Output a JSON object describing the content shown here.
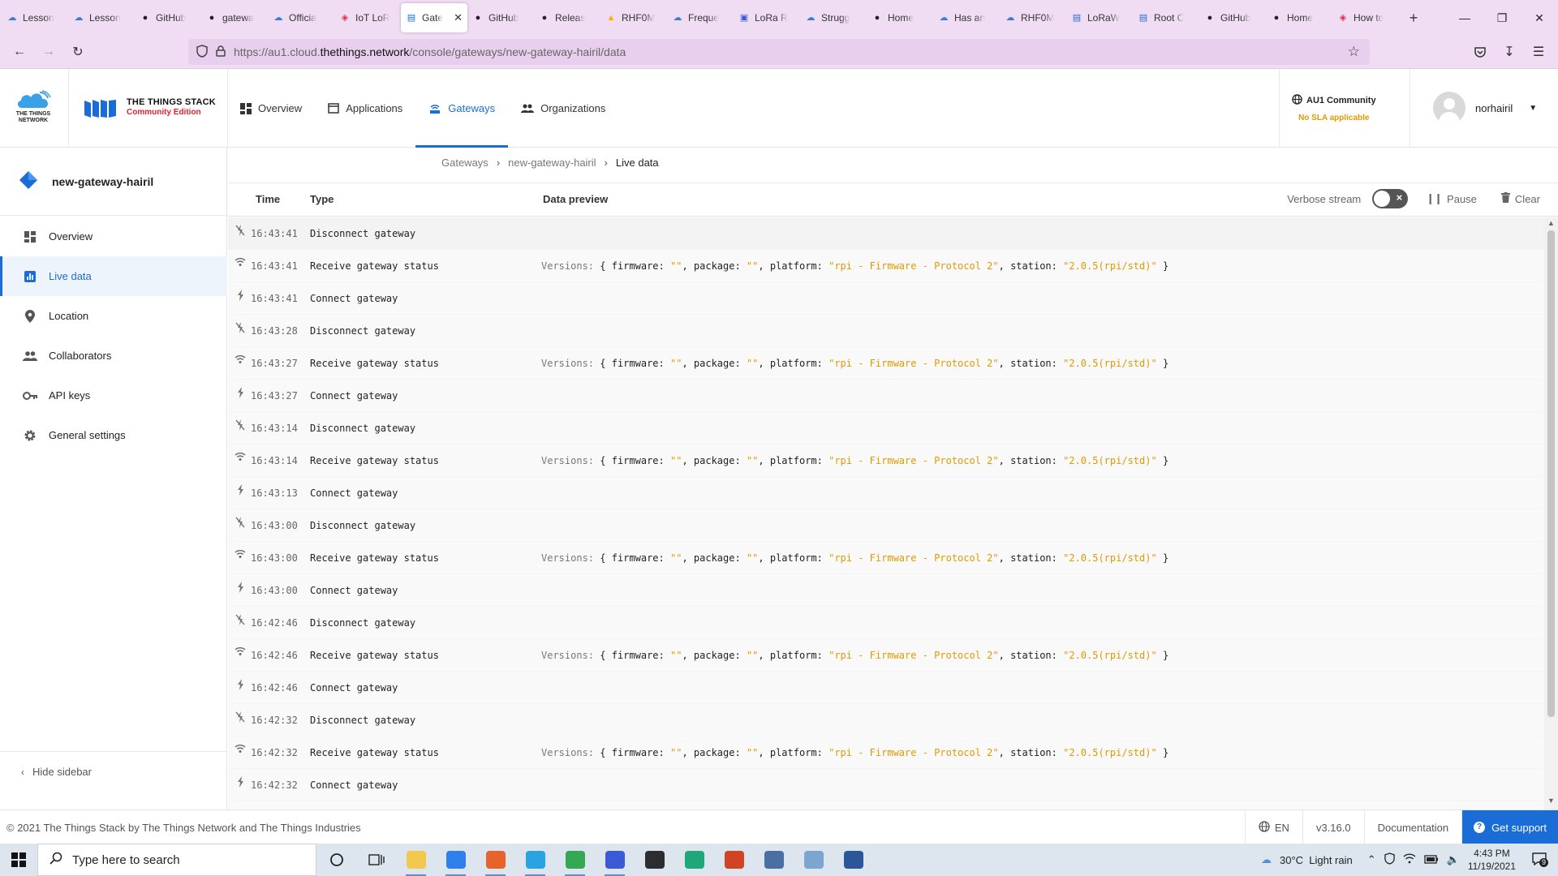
{
  "browser": {
    "tabs": [
      {
        "label": "Lesson",
        "icon": "cloud-icon",
        "color": "#3a7bd5"
      },
      {
        "label": "Lesson",
        "icon": "cloud-icon",
        "color": "#3a7bd5"
      },
      {
        "label": "GitHub",
        "icon": "github-icon",
        "color": "#222222"
      },
      {
        "label": "gatewa",
        "icon": "github-icon",
        "color": "#222222"
      },
      {
        "label": "Officia",
        "icon": "cloud-icon",
        "color": "#3a7bd5"
      },
      {
        "label": "IoT LoR",
        "icon": "shield-icon",
        "color": "#d9304f"
      },
      {
        "label": "Gate",
        "icon": "tts-icon",
        "color": "#1a6dd6",
        "active": true
      },
      {
        "label": "GitHub",
        "icon": "github-icon",
        "color": "#222222"
      },
      {
        "label": "Releas",
        "icon": "github-icon",
        "color": "#222222"
      },
      {
        "label": "RHF0M",
        "icon": "drive-icon",
        "color": "#f4b400"
      },
      {
        "label": "Freque",
        "icon": "cloud-icon",
        "color": "#3a7bd5"
      },
      {
        "label": "LoRa R",
        "icon": "doc-icon",
        "color": "#3a5bd5"
      },
      {
        "label": "Strugg",
        "icon": "cloud-icon",
        "color": "#3a7bd5"
      },
      {
        "label": "Home",
        "icon": "github-icon",
        "color": "#222222"
      },
      {
        "label": "Has an",
        "icon": "cloud-icon",
        "color": "#3a7bd5"
      },
      {
        "label": "RHF0M",
        "icon": "cloud-icon",
        "color": "#3a7bd5"
      },
      {
        "label": "LoRaW",
        "icon": "tts-icon",
        "color": "#1a6dd6"
      },
      {
        "label": "Root C",
        "icon": "tts-icon",
        "color": "#1a6dd6"
      },
      {
        "label": "GitHub",
        "icon": "github-icon",
        "color": "#222222"
      },
      {
        "label": "Home",
        "icon": "github-icon",
        "color": "#222222"
      },
      {
        "label": "How to",
        "icon": "shield-icon",
        "color": "#d9304f"
      }
    ],
    "url_prefix": "https://au1.cloud.",
    "url_domain": "thethings.network",
    "url_path": "/console/gateways/new-gateway-hairil/data"
  },
  "header": {
    "ttn_logo_text": "THE THINGS NETWORK",
    "stack_title": "THE THINGS STACK",
    "stack_subtitle": "Community Edition",
    "nav": [
      {
        "label": "Overview",
        "icon": "dashboard-icon"
      },
      {
        "label": "Applications",
        "icon": "application-icon"
      },
      {
        "label": "Gateways",
        "icon": "gateway-icon",
        "active": true
      },
      {
        "label": "Organizations",
        "icon": "organization-icon"
      }
    ],
    "region_name": "AU1 Community",
    "region_note": "No SLA applicable",
    "user_name": "norhairil"
  },
  "sidebar": {
    "gateway_name": "new-gateway-hairil",
    "items": [
      {
        "label": "Overview",
        "icon": "dashboard-icon"
      },
      {
        "label": "Live data",
        "icon": "bar-chart-icon",
        "active": true
      },
      {
        "label": "Location",
        "icon": "location-pin-icon"
      },
      {
        "label": "Collaborators",
        "icon": "people-icon"
      },
      {
        "label": "API keys",
        "icon": "key-icon"
      },
      {
        "label": "General settings",
        "icon": "gear-icon"
      }
    ],
    "hide_label": "Hide sidebar"
  },
  "breadcrumb": [
    "Gateways",
    "new-gateway-hairil",
    "Live data"
  ],
  "events_header": {
    "time": "Time",
    "type": "Type",
    "preview": "Data preview",
    "verbose": "Verbose stream",
    "pause": "Pause",
    "clear": "Clear"
  },
  "preview": {
    "prefix": "Versions:",
    "open": "{",
    "firmware_key": "firmware:",
    "firmware_val": "\"\"",
    "package_key": "package:",
    "package_val": "\"\"",
    "platform_key": "platform:",
    "platform_val": "\"rpi - Firmware - Protocol 2\"",
    "station_key": "station:",
    "station_val": "\"2.0.5(rpi/std)\"",
    "close": "}"
  },
  "events": [
    {
      "time": "16:43:41",
      "type": "Disconnect gateway",
      "kind": "disconnect"
    },
    {
      "time": "16:43:41",
      "type": "Receive gateway status",
      "kind": "status"
    },
    {
      "time": "16:43:41",
      "type": "Connect gateway",
      "kind": "connect"
    },
    {
      "time": "16:43:28",
      "type": "Disconnect gateway",
      "kind": "disconnect"
    },
    {
      "time": "16:43:27",
      "type": "Receive gateway status",
      "kind": "status"
    },
    {
      "time": "16:43:27",
      "type": "Connect gateway",
      "kind": "connect"
    },
    {
      "time": "16:43:14",
      "type": "Disconnect gateway",
      "kind": "disconnect"
    },
    {
      "time": "16:43:14",
      "type": "Receive gateway status",
      "kind": "status"
    },
    {
      "time": "16:43:13",
      "type": "Connect gateway",
      "kind": "connect"
    },
    {
      "time": "16:43:00",
      "type": "Disconnect gateway",
      "kind": "disconnect"
    },
    {
      "time": "16:43:00",
      "type": "Receive gateway status",
      "kind": "status"
    },
    {
      "time": "16:43:00",
      "type": "Connect gateway",
      "kind": "connect"
    },
    {
      "time": "16:42:46",
      "type": "Disconnect gateway",
      "kind": "disconnect"
    },
    {
      "time": "16:42:46",
      "type": "Receive gateway status",
      "kind": "status"
    },
    {
      "time": "16:42:46",
      "type": "Connect gateway",
      "kind": "connect"
    },
    {
      "time": "16:42:32",
      "type": "Disconnect gateway",
      "kind": "disconnect"
    },
    {
      "time": "16:42:32",
      "type": "Receive gateway status",
      "kind": "status"
    },
    {
      "time": "16:42:32",
      "type": "Connect gateway",
      "kind": "connect"
    }
  ],
  "footer": {
    "copyright": "© 2021 The Things Stack by The Things Network and The Things Industries",
    "language": "EN",
    "version": "v3.16.0",
    "docs": "Documentation",
    "support": "Get support"
  },
  "taskbar": {
    "search_placeholder": "Type here to search",
    "apps": [
      {
        "name": "file-explorer-icon",
        "color": "#f2c94c"
      },
      {
        "name": "mail-icon",
        "color": "#2f80ed"
      },
      {
        "name": "firefox-icon",
        "color": "#e8632b"
      },
      {
        "name": "telegram-icon",
        "color": "#2aa3e0"
      },
      {
        "name": "chrome-icon",
        "color": "#34a853"
      },
      {
        "name": "network-tool-icon",
        "color": "#3a5bd5"
      },
      {
        "name": "sticky-notes-icon",
        "color": "#2d2d2d"
      },
      {
        "name": "edge-icon",
        "color": "#1fa67a"
      },
      {
        "name": "powerpoint-icon",
        "color": "#d04423"
      },
      {
        "name": "remote-desktop-icon",
        "color": "#4a6fa5"
      },
      {
        "name": "file-manager-icon",
        "color": "#7ca5cf"
      },
      {
        "name": "word-icon",
        "color": "#2b579a"
      }
    ],
    "weather": "30°C  Light rain",
    "time": "4:43 PM",
    "date": "11/19/2021",
    "notifications": "9"
  }
}
